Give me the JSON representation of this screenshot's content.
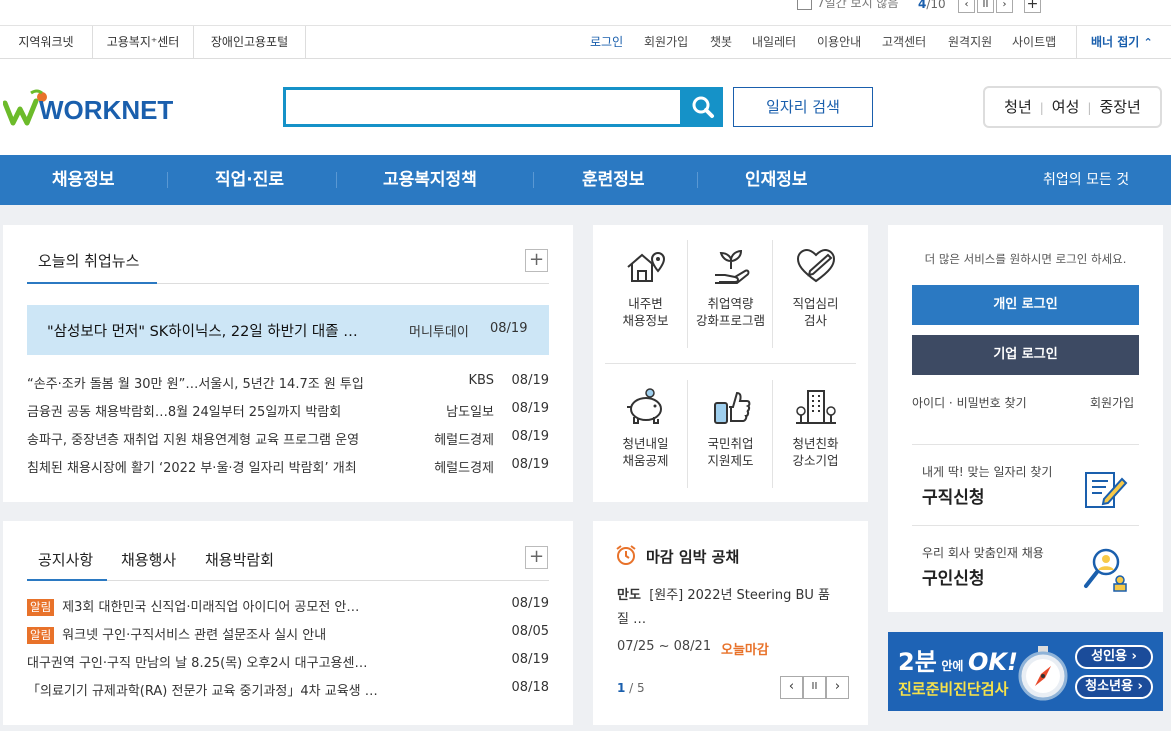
{
  "top_strip": {
    "hide_label": "7일간 보지 않음",
    "page_current": "4",
    "page_total": "/10",
    "prev": "‹",
    "pause": "II",
    "next": "›",
    "plus": "+"
  },
  "util": {
    "family_sites": [
      "지역워크넷",
      "고용복지⁺센터",
      "장애인고용포털"
    ],
    "links": [
      "로그인",
      "회원가입",
      "챗봇",
      "내일레터",
      "이용안내",
      "고객센터",
      "원격지원",
      "사이트맵"
    ],
    "banner_fold": "배너 접기"
  },
  "header": {
    "logo_text": "WORKNET",
    "search_placeholder": "",
    "job_search": "일자리 검색",
    "targets": [
      "청년",
      "여성",
      "중장년"
    ]
  },
  "gnb": {
    "items": [
      "채용정보",
      "직업·진로",
      "고용복지정책",
      "훈련정보",
      "인재정보"
    ],
    "all": "취업의 모든 것"
  },
  "news": {
    "title": "오늘의 취업뉴스",
    "headline": {
      "title": "\"삼성보다 먼저\" SK하이닉스, 22일 하반기 대졸 …",
      "source": "머니투데이",
      "date": "08/19"
    },
    "items": [
      {
        "title": "“손주·조카 돌봄 월 30만 원”…서울시, 5년간 14.7조 원 투입",
        "source": "KBS",
        "date": "08/19"
      },
      {
        "title": "금융권 공동 채용박람회…8월 24일부터 25일까지 박람회",
        "source": "남도일보",
        "date": "08/19"
      },
      {
        "title": "송파구, 중장년층 재취업 지원 채용연계형 교육 프로그램 운영",
        "source": "헤럴드경제",
        "date": "08/19"
      },
      {
        "title": "침체된 채용시장에 활기 ‘2022 부·울·경 일자리 박람회’ 개최",
        "source": "헤럴드경제",
        "date": "08/19"
      }
    ]
  },
  "services": [
    {
      "line1": "내주변",
      "line2": "채용정보",
      "icon": "house-location-icon"
    },
    {
      "line1": "취업역량",
      "line2": "강화프로그램",
      "icon": "sprout-hand-icon"
    },
    {
      "line1": "직업심리",
      "line2": "검사",
      "icon": "heart-pen-icon"
    },
    {
      "line1": "청년내일",
      "line2": "채움공제",
      "icon": "piggy-bank-icon"
    },
    {
      "line1": "국민취업",
      "line2": "지원제도",
      "icon": "thumbs-up-phone-icon"
    },
    {
      "line1": "청년친화",
      "line2": "강소기업",
      "icon": "building-icon"
    }
  ],
  "login": {
    "message": "더 많은 서비스를 원하시면 로그인 하세요.",
    "personal": "개인 로그인",
    "company": "기업 로그인",
    "find": "아이디 · 비밀번호 찾기",
    "join": "회원가입",
    "job_apply_sub": "내게 딱! 맞는 일자리 찾기",
    "job_apply": "구직신청",
    "talent_sub": "우리 회사 맞춤인재 채용",
    "talent": "구인신청"
  },
  "notice": {
    "tabs": [
      "공지사항",
      "채용행사",
      "채용박람회"
    ],
    "tag": "알림",
    "items": [
      {
        "tagged": true,
        "title": "제3회 대한민국 신직업·미래직업 아이디어 공모전 안…",
        "date": "08/19"
      },
      {
        "tagged": true,
        "title": "워크넷 구인·구직서비스 관련 설문조사 실시 안내",
        "date": "08/05"
      },
      {
        "tagged": false,
        "title": "대구권역 구인·구직 만남의 날 8.25(목) 오후2시 대구고용센…",
        "date": "08/19"
      },
      {
        "tagged": false,
        "title": "「의료기기 규제과학(RA) 전문가 교육 중기과정」4차 교육생 …",
        "date": "08/18"
      }
    ]
  },
  "deadline": {
    "title": "마감 임박 공채",
    "company": "만도",
    "job_line1": "[원주] 2022년 Steering BU 품",
    "job_line2": "질 …",
    "period": "07/25 ~ 08/21",
    "status": "오늘마감",
    "page_current": "1",
    "page_total": " / 5"
  },
  "ad": {
    "big": "2분",
    "small": "안에",
    "ok": "OK!",
    "sub": "진로준비진단검사",
    "adult": "성인용 ›",
    "youth": "청소년용 ›"
  },
  "colors": {
    "primary": "#2b79c2",
    "search": "#1592c8",
    "accent": "#e8722a",
    "dark_btn": "#3d4a63"
  }
}
